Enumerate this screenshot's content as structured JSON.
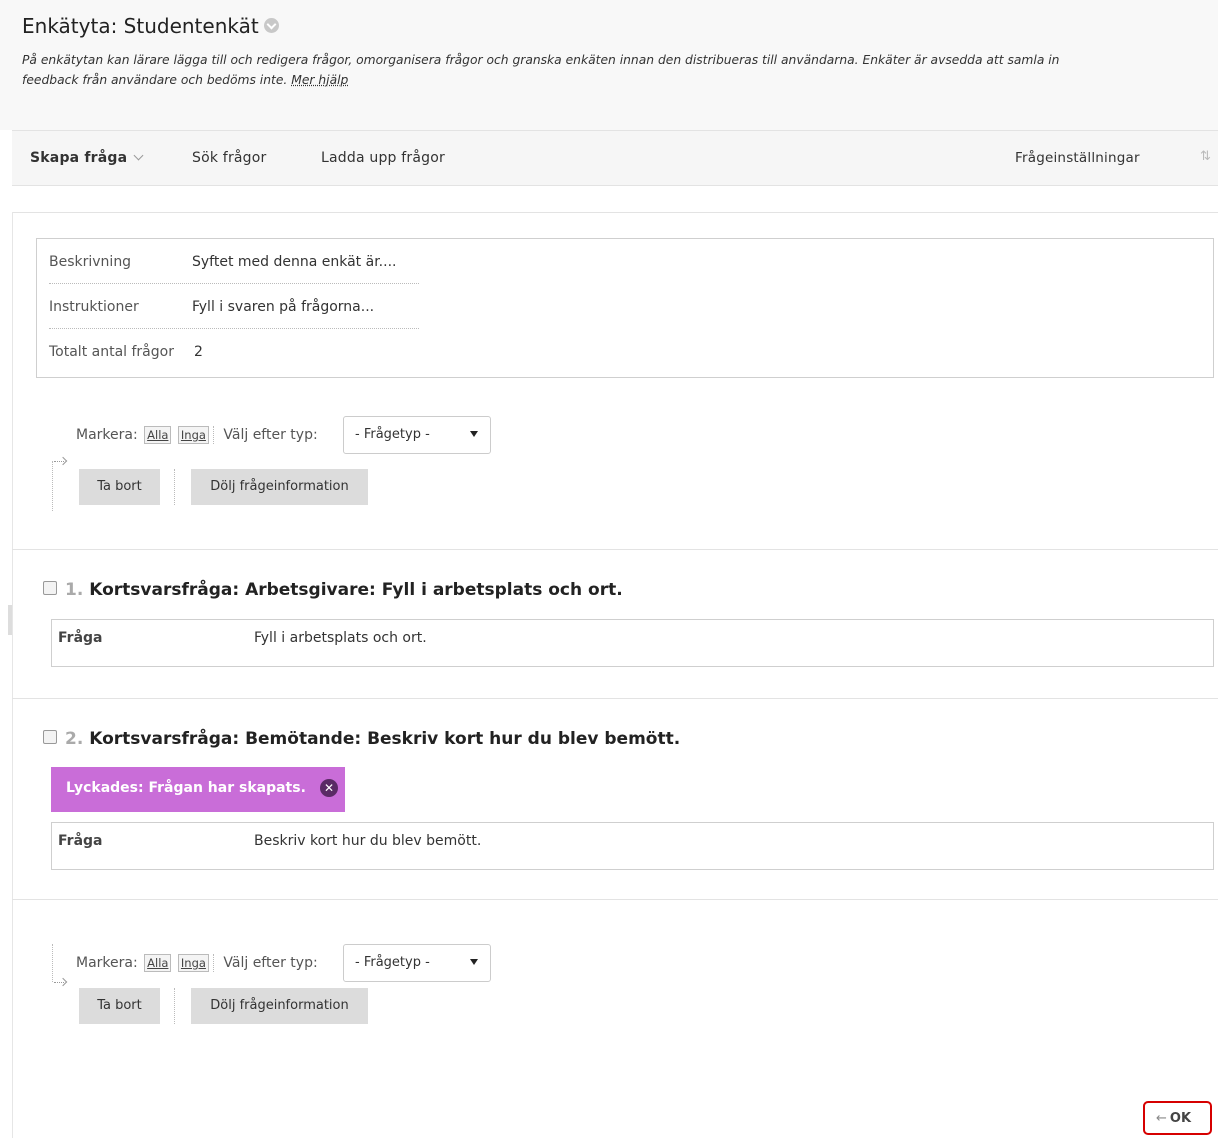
{
  "header": {
    "title": "Enkätyta: Studentenkät",
    "description_line1": "På enkätytan kan lärare lägga till och redigera frågor, omorganisera frågor och granska enkäten innan den distribueras till användarna. Enkäter är avsedda att samla in",
    "description_line2": "feedback från användare och bedöms inte.",
    "help_link": "Mer hjälp"
  },
  "toolbar": {
    "create_question": "Skapa fråga",
    "search_questions": "Sök frågor",
    "upload_questions": "Ladda upp frågor",
    "question_settings": "Frågeinställningar",
    "sort_icon": "⇅"
  },
  "info": {
    "description_label": "Beskrivning",
    "description_value": "Syftet med denna enkät är....",
    "instructions_label": "Instruktioner",
    "instructions_value": "Fyll i svaren på frågorna...",
    "total_label": "Totalt antal frågor",
    "total_value": "2"
  },
  "controls": {
    "select_label": "Markera:",
    "all": "Alla",
    "none": "Inga",
    "filter_label": "Välj efter typ:",
    "type_placeholder": "- Frågetyp -",
    "remove_button": "Ta bort",
    "hide_info_button": "Dölj frågeinformation"
  },
  "questions": [
    {
      "number": "1.",
      "title": "Kortsvarsfråga: Arbetsgivare: Fyll i arbetsplats och ort.",
      "field_label": "Fråga",
      "field_value": "Fyll i arbetsplats och ort."
    },
    {
      "number": "2.",
      "title": "Kortsvarsfråga: Bemötande: Beskriv kort hur du blev bemött.",
      "field_label": "Fråga",
      "field_value": "Beskriv kort hur du blev bemött."
    }
  ],
  "success_message": "Lyckades: Frågan har skapats.",
  "ok_button": "OK",
  "ok_arrow": "←",
  "colors": {
    "success_bg": "#c96dd8",
    "ok_border": "#d60000"
  }
}
